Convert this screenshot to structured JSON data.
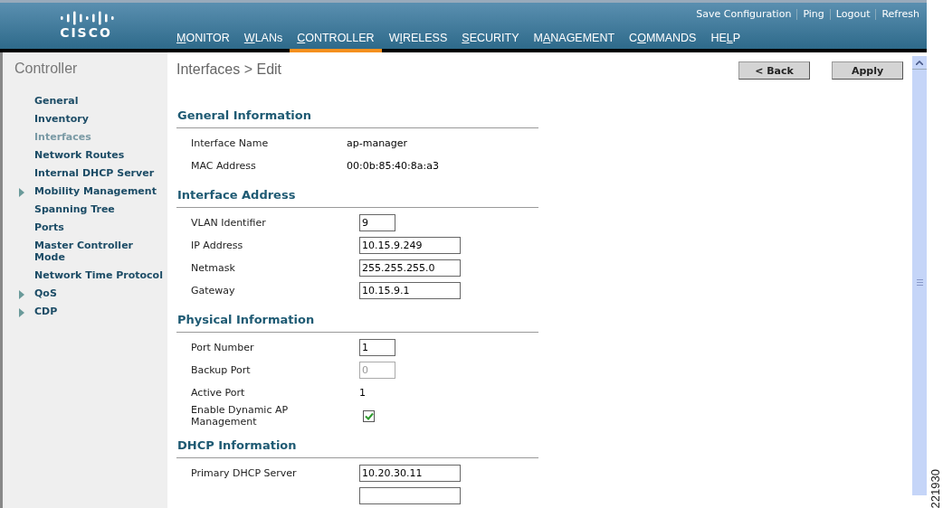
{
  "header": {
    "logo_text": "CISCO",
    "top_links": [
      "Save Configuration",
      "Ping",
      "Logout",
      "Refresh"
    ],
    "nav": [
      {
        "key": "M",
        "after": "ONITOR",
        "selected": false
      },
      {
        "key": "W",
        "after": "LANs",
        "selected": false
      },
      {
        "key": "C",
        "after": "ONTROLLER",
        "selected": true
      },
      {
        "before": "W",
        "key": "I",
        "after": "RELESS",
        "selected": false
      },
      {
        "key": "S",
        "after": "ECURITY",
        "selected": false
      },
      {
        "before": "M",
        "key": "A",
        "after": "NAGEMENT",
        "selected": false
      },
      {
        "before": "C",
        "key": "O",
        "after": "MMANDS",
        "selected": false
      },
      {
        "before": "HE",
        "key": "L",
        "after": "P",
        "selected": false
      }
    ]
  },
  "sidebar": {
    "title": "Controller",
    "items": [
      {
        "label": "General",
        "selected": false,
        "expandable": false
      },
      {
        "label": "Inventory",
        "selected": false,
        "expandable": false
      },
      {
        "label": "Interfaces",
        "selected": true,
        "expandable": false
      },
      {
        "label": "Network Routes",
        "selected": false,
        "expandable": false
      },
      {
        "label": "Internal DHCP Server",
        "selected": false,
        "expandable": false
      },
      {
        "label": "Mobility Management",
        "selected": false,
        "expandable": true
      },
      {
        "label": "Spanning Tree",
        "selected": false,
        "expandable": false
      },
      {
        "label": "Ports",
        "selected": false,
        "expandable": false
      },
      {
        "label": "Master Controller Mode",
        "selected": false,
        "expandable": false
      },
      {
        "label": "Network Time Protocol",
        "selected": false,
        "expandable": false
      },
      {
        "label": "QoS",
        "selected": false,
        "expandable": true
      },
      {
        "label": "CDP",
        "selected": false,
        "expandable": true
      }
    ]
  },
  "page": {
    "title": "Interfaces > Edit",
    "buttons": [
      "< Back",
      "Apply"
    ],
    "sections": [
      {
        "title": "General Information",
        "rows": [
          {
            "kind": "text",
            "label": "Interface Name",
            "value": "ap-manager"
          },
          {
            "kind": "text",
            "label": "MAC Address",
            "value": "00:0b:85:40:8a:a3"
          }
        ]
      },
      {
        "title": "Interface Address",
        "rows": [
          {
            "kind": "short_input",
            "label": "VLAN Identifier",
            "value": "9",
            "disabled": false
          },
          {
            "kind": "long_input",
            "label": "IP Address",
            "value": "10.15.9.249",
            "disabled": false
          },
          {
            "kind": "long_input",
            "label": "Netmask",
            "value": "255.255.255.0",
            "disabled": false
          },
          {
            "kind": "long_input",
            "label": "Gateway",
            "value": "10.15.9.1",
            "disabled": false
          }
        ]
      },
      {
        "title": "Physical Information",
        "rows": [
          {
            "kind": "short_input",
            "label": "Port Number",
            "value": "1",
            "disabled": false
          },
          {
            "kind": "short_input",
            "label": "Backup Port",
            "value": "0",
            "disabled": true
          },
          {
            "kind": "plain",
            "label": "Active Port",
            "value": "1"
          },
          {
            "kind": "checkbox",
            "label": "Enable Dynamic AP Management",
            "checked": true
          }
        ]
      },
      {
        "title": "DHCP Information",
        "rows": [
          {
            "kind": "long_input",
            "label": "Primary DHCP Server",
            "value": "10.20.30.11",
            "disabled": false
          },
          {
            "kind": "long_input",
            "disabled": false
          }
        ]
      }
    ]
  },
  "figure_id": "221930"
}
